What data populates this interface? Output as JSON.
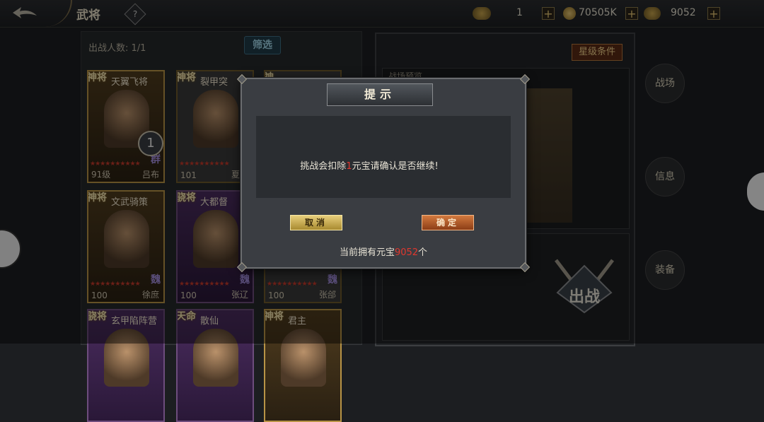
{
  "header": {
    "title": "武将",
    "help": "?",
    "resources": [
      {
        "icon": "horse-icon",
        "value": "1"
      },
      {
        "icon": "copper-coin-icon",
        "value": "70505K"
      },
      {
        "icon": "ingot-icon",
        "value": "9052"
      }
    ],
    "plus": "+"
  },
  "left": {
    "battle_count_label": "出战人数: 1/1",
    "filter_label": "筛选",
    "cards": [
      {
        "badge": "神将",
        "name": "天翼飞将",
        "level": "91级",
        "general": "吕布",
        "faction": "群",
        "count": "1",
        "style": "gold"
      },
      {
        "badge": "神将",
        "name": "裂甲突",
        "level": "101",
        "general": "夏侯",
        "faction": "",
        "count": "",
        "style": "plain"
      },
      {
        "badge": "神",
        "name": "",
        "level": "",
        "general": "",
        "faction": "",
        "count": "",
        "style": "plain"
      },
      {
        "badge": "神将",
        "name": "文武骑策",
        "level": "100",
        "general": "徐庶",
        "faction": "魏",
        "count": "",
        "style": "gold"
      },
      {
        "badge": "骁将",
        "name": "大都督",
        "level": "100",
        "general": "张辽",
        "faction": "魏",
        "count": "",
        "style": "purple"
      },
      {
        "badge": "",
        "name": "",
        "level": "100",
        "general": "张郃",
        "faction": "魏",
        "count": "",
        "style": "plain"
      },
      {
        "badge": "骁将",
        "name": "玄甲陷阵营",
        "level": "",
        "general": "",
        "faction": "",
        "count": "",
        "style": "purple"
      },
      {
        "badge": "天命",
        "name": "散仙",
        "level": "",
        "general": "",
        "faction": "",
        "count": "",
        "style": "purple"
      },
      {
        "badge": "神将",
        "name": "君主",
        "level": "",
        "general": "",
        "faction": "",
        "count": "",
        "style": "gold"
      }
    ]
  },
  "right": {
    "star_condition": "星级条件",
    "map_label": "战场预览",
    "battle_button": "出战",
    "side_tabs": [
      "战场",
      "信息",
      "装备"
    ]
  },
  "dialog": {
    "title": "提示",
    "message_pre": "挑战会扣除",
    "message_num": "1",
    "message_post": "元宝请确认是否继续!",
    "cancel": "取消",
    "confirm": "确定",
    "owned_pre": "当前拥有元宝",
    "owned_num": "9052",
    "owned_post": "个"
  }
}
